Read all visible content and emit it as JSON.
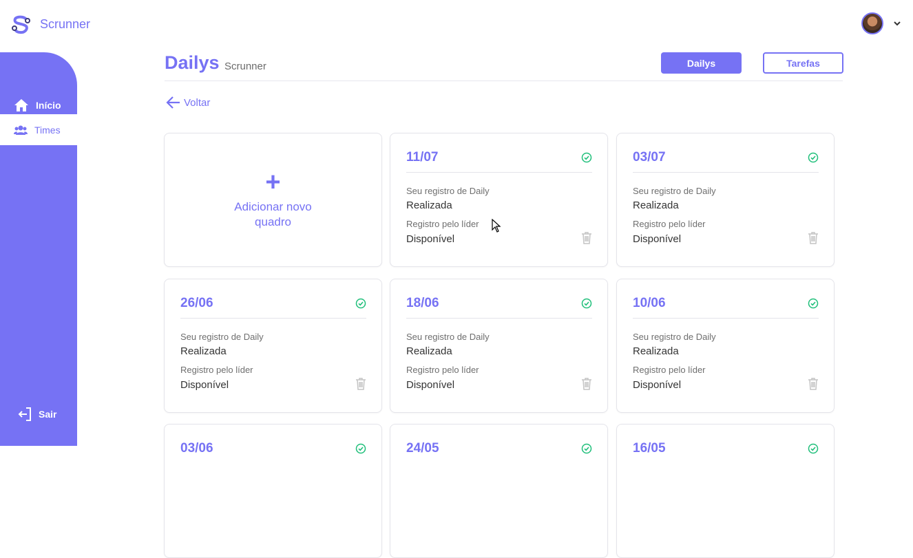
{
  "app": {
    "brand": "Scrunner"
  },
  "sidebar": {
    "items": [
      {
        "label": "Início",
        "icon": "home-icon"
      },
      {
        "label": "Times",
        "icon": "team-icon"
      }
    ],
    "logout": {
      "label": "Sair",
      "icon": "logout-icon"
    }
  },
  "header": {
    "title": "Dailys",
    "subtitle": "Scrunner",
    "tabs": [
      {
        "label": "Dailys"
      },
      {
        "label": "Tarefas"
      }
    ],
    "back_label": "Voltar"
  },
  "add_card": {
    "plus": "+",
    "label": "Adicionar novo quadro"
  },
  "field_labels": {
    "own": "Seu registro de Daily",
    "leader": "Registro pelo líder"
  },
  "cards": [
    {
      "date": "11/07",
      "own_value": "Realizada",
      "leader_value": "Disponível"
    },
    {
      "date": "03/07",
      "own_value": "Realizada",
      "leader_value": "Disponível"
    },
    {
      "date": "26/06",
      "own_value": "Realizada",
      "leader_value": "Disponível"
    },
    {
      "date": "18/06",
      "own_value": "Realizada",
      "leader_value": "Disponível"
    },
    {
      "date": "10/06",
      "own_value": "Realizada",
      "leader_value": "Disponível"
    },
    {
      "date": "03/06",
      "own_value": "",
      "leader_value": ""
    },
    {
      "date": "24/05",
      "own_value": "",
      "leader_value": ""
    },
    {
      "date": "16/05",
      "own_value": "",
      "leader_value": ""
    }
  ],
  "colors": {
    "accent": "#7672f4",
    "success": "#1fbf7a",
    "muted": "#c4c4c4"
  }
}
